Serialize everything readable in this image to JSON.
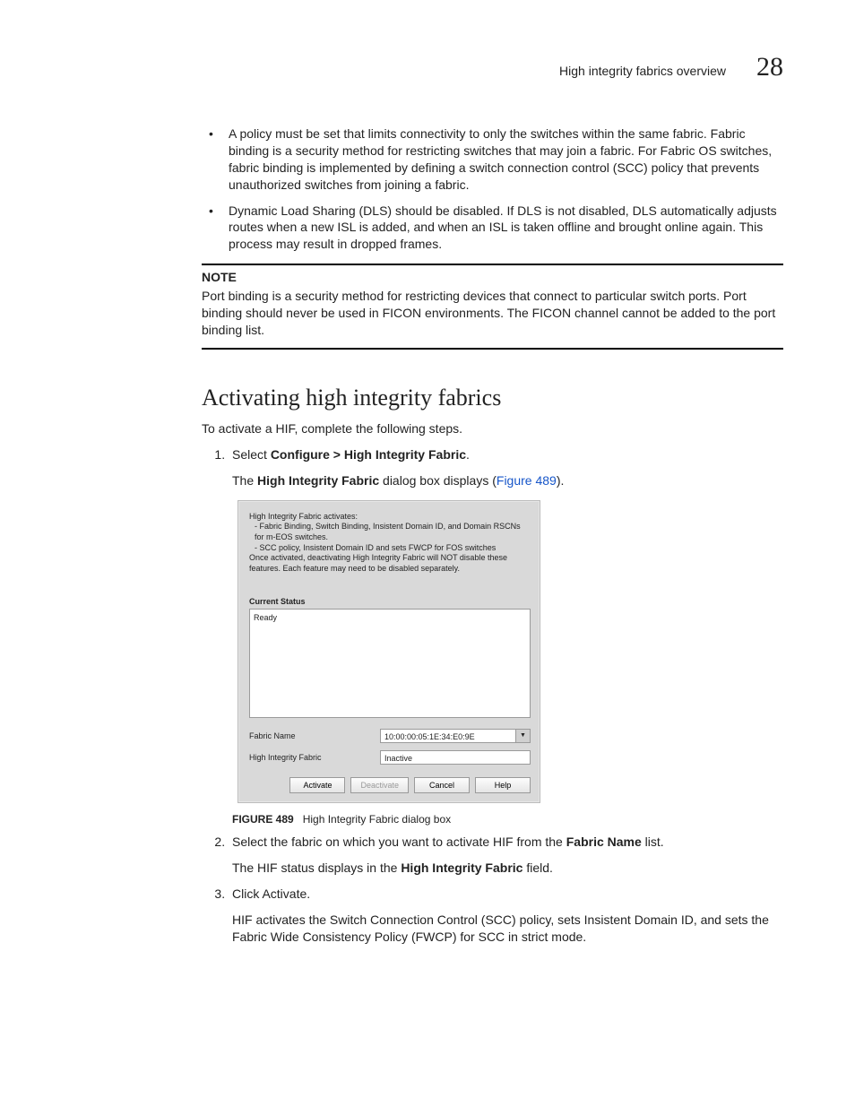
{
  "header": {
    "running_title": "High integrity fabrics overview",
    "chapter_number": "28"
  },
  "bullets": [
    "A policy must be set that limits connectivity to only the switches within the same fabric. Fabric binding is a security method for restricting switches that may join a fabric. For Fabric OS switches, fabric binding is implemented by defining a switch connection control (SCC) policy that prevents unauthorized switches from joining a fabric.",
    "Dynamic Load Sharing (DLS) should be disabled. If DLS is not disabled, DLS automatically adjusts routes when a new ISL is added, and when an ISL is taken offline and brought online again. This process may result in dropped frames."
  ],
  "note": {
    "label": "NOTE",
    "body": "Port binding is a security method for restricting devices that connect to particular switch ports. Port binding should never be used in FICON environments. The FICON channel cannot be added to the port binding list."
  },
  "section_heading": "Activating high integrity fabrics",
  "section_intro": "To activate a HIF, complete the following steps.",
  "steps": {
    "s1_pre": "Select ",
    "s1_bold": "Configure > High Integrity Fabric",
    "s1_after": ".",
    "s1_sub_pre": "The ",
    "s1_sub_bold": "High Integrity Fabric",
    "s1_sub_mid": " dialog box displays (",
    "s1_sub_link": "Figure 489",
    "s1_sub_after": ").",
    "s2_pre": "Select the fabric on which you want to activate HIF from the ",
    "s2_bold": "Fabric Name",
    "s2_after": " list.",
    "s2_sub_pre": "The HIF status displays in the ",
    "s2_sub_bold": "High Integrity Fabric",
    "s2_sub_after": " field.",
    "s3": "Click Activate.",
    "s3_sub": "HIF activates the Switch Connection Control (SCC) policy, sets Insistent Domain ID, and sets the Fabric Wide Consistency Policy (FWCP) for SCC in strict mode."
  },
  "dialog": {
    "desc_line1": "High Integrity Fabric activates:",
    "desc_line2": "  - Fabric Binding, Switch Binding, Insistent Domain ID, and Domain RSCNs for m-EOS switches.",
    "desc_line3": "  - SCC policy, Insistent Domain ID and sets FWCP for FOS switches",
    "desc_line4": "Once activated, deactivating High Integrity Fabric will NOT disable these features.  Each feature may need to be disabled separately.",
    "current_status_label": "Current Status",
    "current_status_value": "Ready",
    "fabric_name_label": "Fabric Name",
    "fabric_name_value": "10:00:00:05:1E:34:E0:9E",
    "hif_label": "High Integrity Fabric",
    "hif_value": "Inactive",
    "btn_activate": "Activate",
    "btn_deactivate": "Deactivate",
    "btn_cancel": "Cancel",
    "btn_help": "Help"
  },
  "figure": {
    "label": "FIGURE 489",
    "caption": "High Integrity Fabric dialog box"
  }
}
